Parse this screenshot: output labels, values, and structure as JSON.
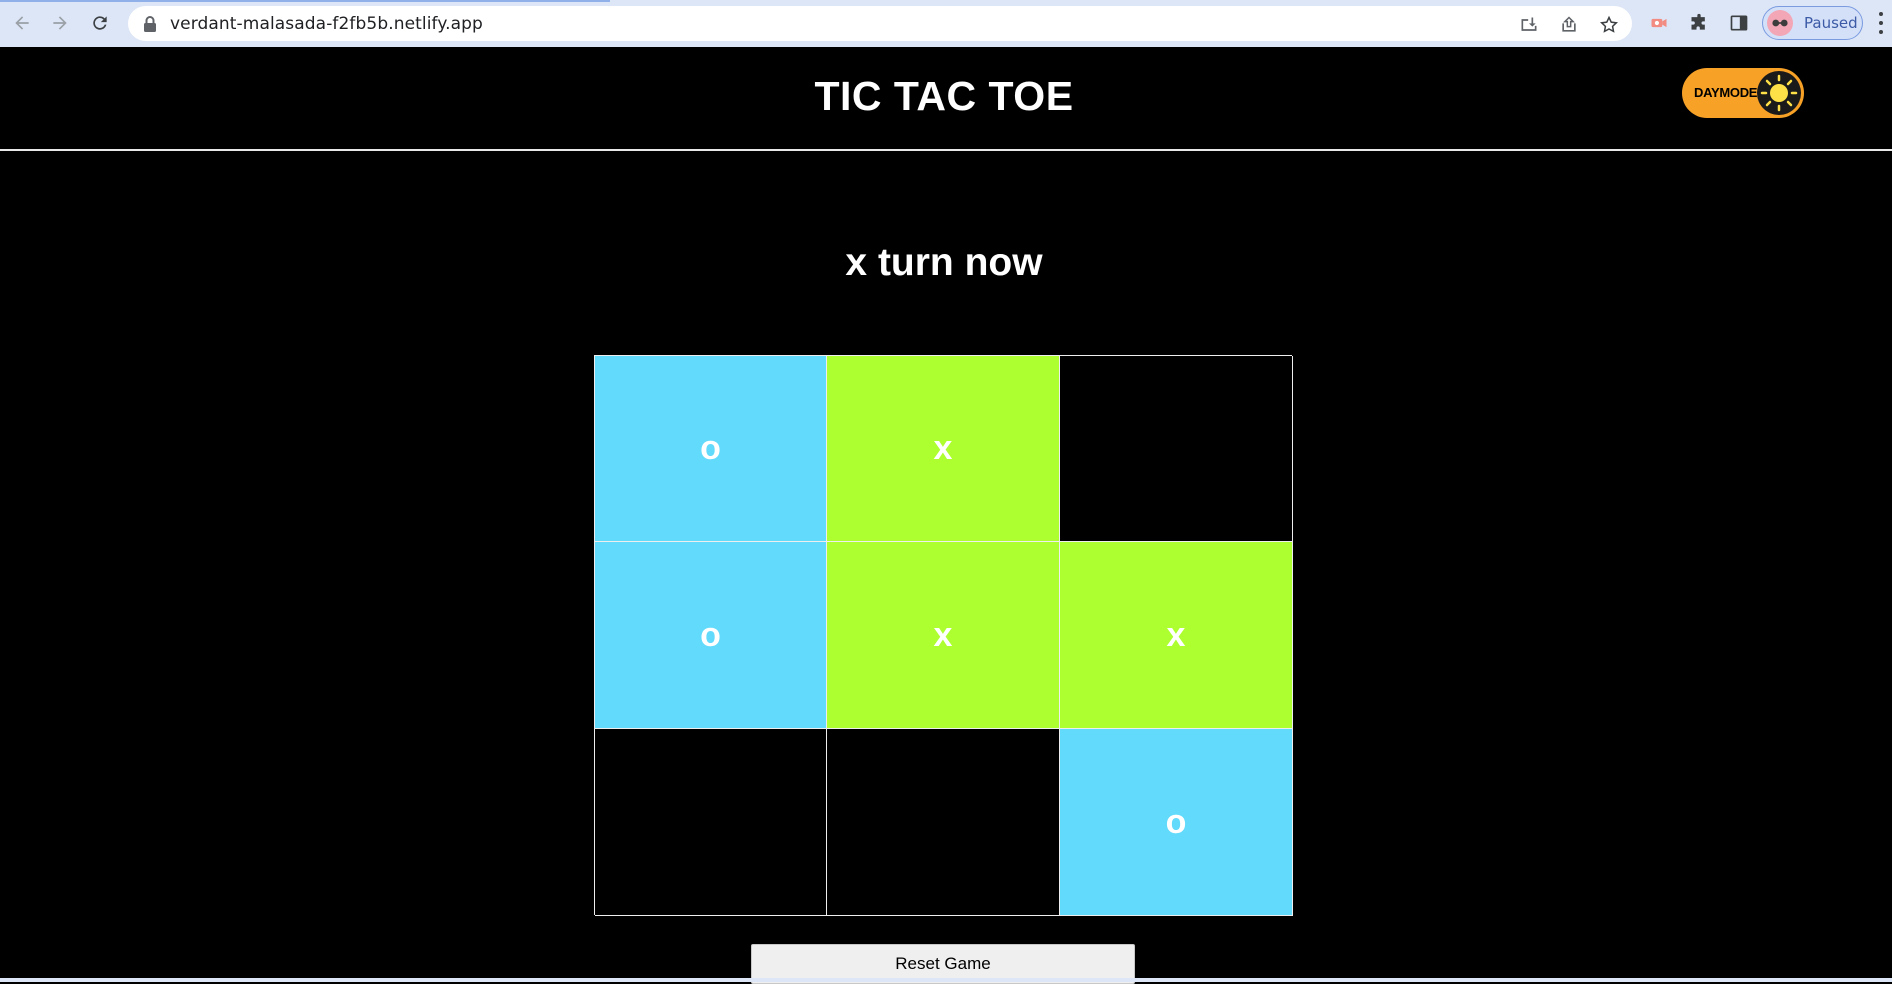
{
  "browser": {
    "url": "verdant-malasada-f2fb5b.netlify.app",
    "profile_status": "Paused",
    "icons": [
      "back-icon",
      "forward-icon",
      "reload-icon",
      "lock-icon",
      "install-icon",
      "share-icon",
      "star-icon",
      "extension-record-icon",
      "puzzle-icon",
      "sidepanel-icon",
      "menu-icon"
    ]
  },
  "app": {
    "title": "TIC TAC TOE",
    "theme_toggle_label": "DAYMODE",
    "status": "x turn now",
    "reset_label": "Reset Game"
  },
  "board": {
    "colors": {
      "o": "#61dafb",
      "x": "#adff2f",
      "empty": "#000000"
    },
    "cells": [
      "o",
      "x",
      "",
      "o",
      "x",
      "x",
      "",
      "",
      "o"
    ]
  },
  "colors": {
    "theme_toggle": "#f7a126",
    "chrome": "#dde6f7"
  }
}
